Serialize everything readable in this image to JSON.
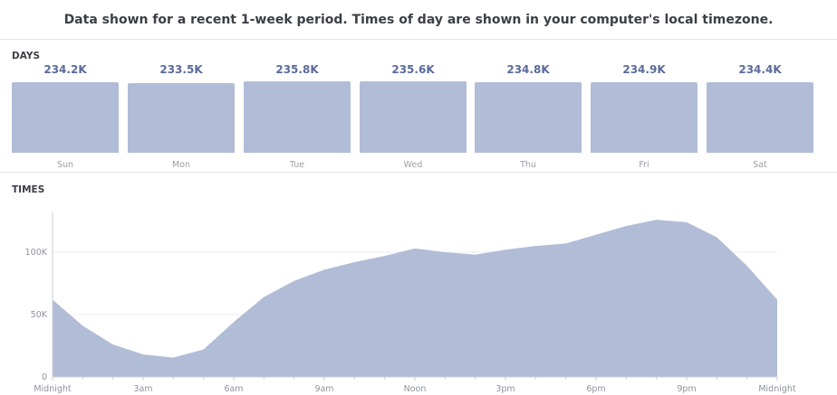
{
  "header": {
    "text": "Data shown for a recent 1-week period. Times of day are shown in your computer's local timezone."
  },
  "days_section": {
    "label": "DAYS"
  },
  "times_section": {
    "label": "TIMES"
  },
  "colors": {
    "bar": "#b1bcd6",
    "area": "#b1bcd6",
    "value_text": "#5b6b9a"
  },
  "chart_data": [
    {
      "type": "bar",
      "categories": [
        "Sun",
        "Mon",
        "Tue",
        "Wed",
        "Thu",
        "Fri",
        "Sat"
      ],
      "value_labels": [
        "234.2K",
        "233.5K",
        "235.8K",
        "235.6K",
        "234.8K",
        "234.9K",
        "234.4K"
      ],
      "values": [
        234200,
        233500,
        235800,
        235600,
        234800,
        234900,
        234400
      ]
    },
    {
      "type": "area",
      "x_ticks": [
        "Midnight",
        "3am",
        "6am",
        "9am",
        "Noon",
        "3pm",
        "6pm",
        "9pm",
        "Midnight"
      ],
      "y_ticks": [
        "0",
        "50K",
        "100K"
      ],
      "ylim": [
        0,
        150000
      ],
      "x": [
        0,
        1,
        2,
        3,
        4,
        5,
        6,
        7,
        8,
        9,
        10,
        11,
        12,
        13,
        14,
        15,
        16,
        17,
        18,
        19,
        20,
        21,
        22,
        23,
        24
      ],
      "values": [
        62000,
        41000,
        26000,
        18000,
        15500,
        22000,
        44000,
        64000,
        77000,
        86000,
        92000,
        97000,
        103000,
        100000,
        98000,
        102000,
        105000,
        107000,
        114000,
        121000,
        126000,
        124000,
        112000,
        89000,
        62000
      ],
      "grid": true
    }
  ]
}
